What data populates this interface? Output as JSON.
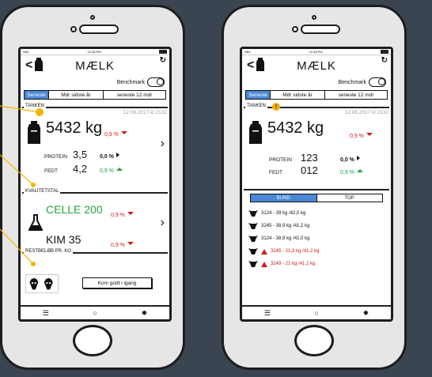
{
  "status": {
    "carrier": "ABC",
    "time": "12:38 PM"
  },
  "header": {
    "title": "MÆLK",
    "back": "<",
    "refresh": "↻"
  },
  "benchmark": {
    "label": "Benchmark"
  },
  "tabs": [
    "Seneste",
    "Mdr sidste år",
    "seneste 12 mdr"
  ],
  "tank": {
    "label": "TANKEN",
    "date": "12.06.2017 kl 2132",
    "volume": "5432 kg",
    "volume_pct": "0,9 %",
    "protein_label": "PROTEIN",
    "protein_value": "3,5",
    "protein_pct": "0,0 %",
    "fat_label": "FEDT",
    "fat_value": "4,2",
    "fat_pct": "0,9 %"
  },
  "tank2": {
    "protein_value": "123",
    "fat_value": "012"
  },
  "quality": {
    "label": "KVALITETSTAL",
    "celle": "CELLE 200",
    "celle_pct": "0,9 %",
    "kim": "KIM 35",
    "kim_pct": "0,9 %"
  },
  "rest": {
    "label": "RESTBELØB PR. KO",
    "button": "Kom godt i igang"
  },
  "segment": [
    "BUND",
    "TOP"
  ],
  "cows": [
    {
      "text": "3124 - 39 kg /42,0 kg",
      "warn": false
    },
    {
      "text": "3245 - 38,9 kg /41,2 kg",
      "warn": false
    },
    {
      "text": "3124 - 38,9 kg /42,0 kg",
      "warn": false
    },
    {
      "text": "3245 - 21,3 kg /41,2 kg",
      "warn": true
    },
    {
      "text": "3249 - 21 kg /41,1 kg",
      "warn": true
    }
  ],
  "bottom": {
    "list": "☰",
    "circle": "○",
    "gear": "✹"
  },
  "colors": {
    "accent": "#4a87d6",
    "up": "#1fa53c",
    "down": "#d01e1e",
    "marker": "#f4b400",
    "background": "#3a4551"
  }
}
